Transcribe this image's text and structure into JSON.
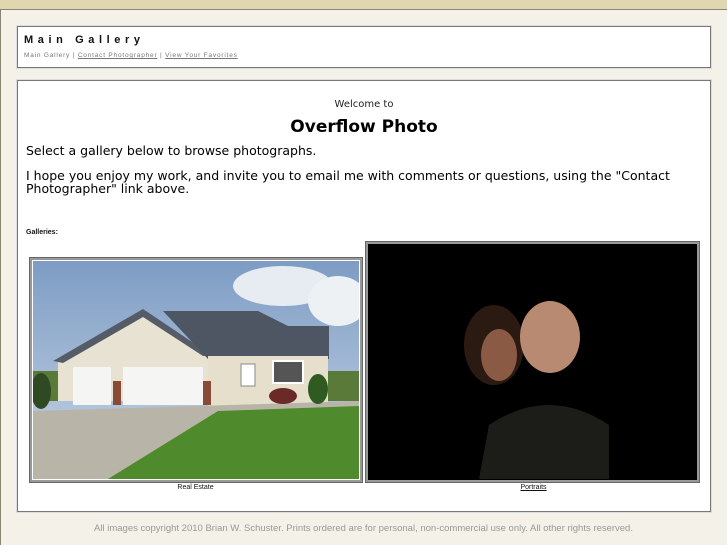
{
  "header": {
    "title": "Main Gallery",
    "nav": {
      "current": "Main Gallery",
      "sep": "|",
      "links": [
        "Contact Photographer",
        "View Your Favorites"
      ]
    }
  },
  "main": {
    "welcome": "Welcome to",
    "site_title": "Overflow Photo",
    "intro": "Select a gallery below to browse photographs.",
    "message": "I hope you enjoy my work, and invite you to email me with comments or questions, using the \"Contact Photographer\" link above.",
    "galleries_label": "Galleries:",
    "galleries": [
      {
        "label": "Real Estate"
      },
      {
        "label": "Portraits"
      }
    ]
  },
  "footer": "All images copyright 2010 Brian W. Schuster. Prints ordered are for personal, non-commercial use only. All other rights reserved."
}
